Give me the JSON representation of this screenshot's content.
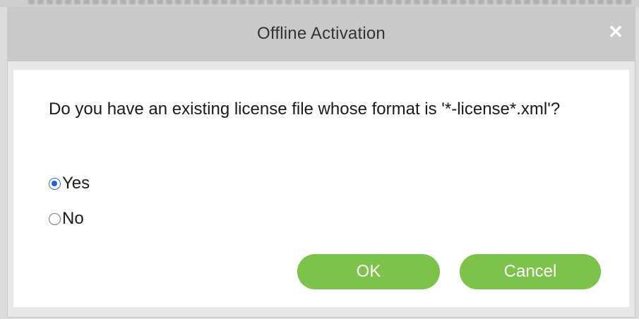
{
  "dialog": {
    "title": "Offline Activation",
    "close_glyph": "✕",
    "question": "Do you have an existing license file whose format is '*-license*.xml'?",
    "options": [
      {
        "label": "Yes",
        "checked": true
      },
      {
        "label": "No",
        "checked": false
      }
    ],
    "ok_label": "OK",
    "cancel_label": "Cancel"
  },
  "colors": {
    "titlebar": "#c9c9c9",
    "button_green": "#7cc24b",
    "radio_selected": "#1f5fd8"
  },
  "icons": [
    "close-icon",
    "radio-checked-icon",
    "radio-unchecked-icon"
  ]
}
